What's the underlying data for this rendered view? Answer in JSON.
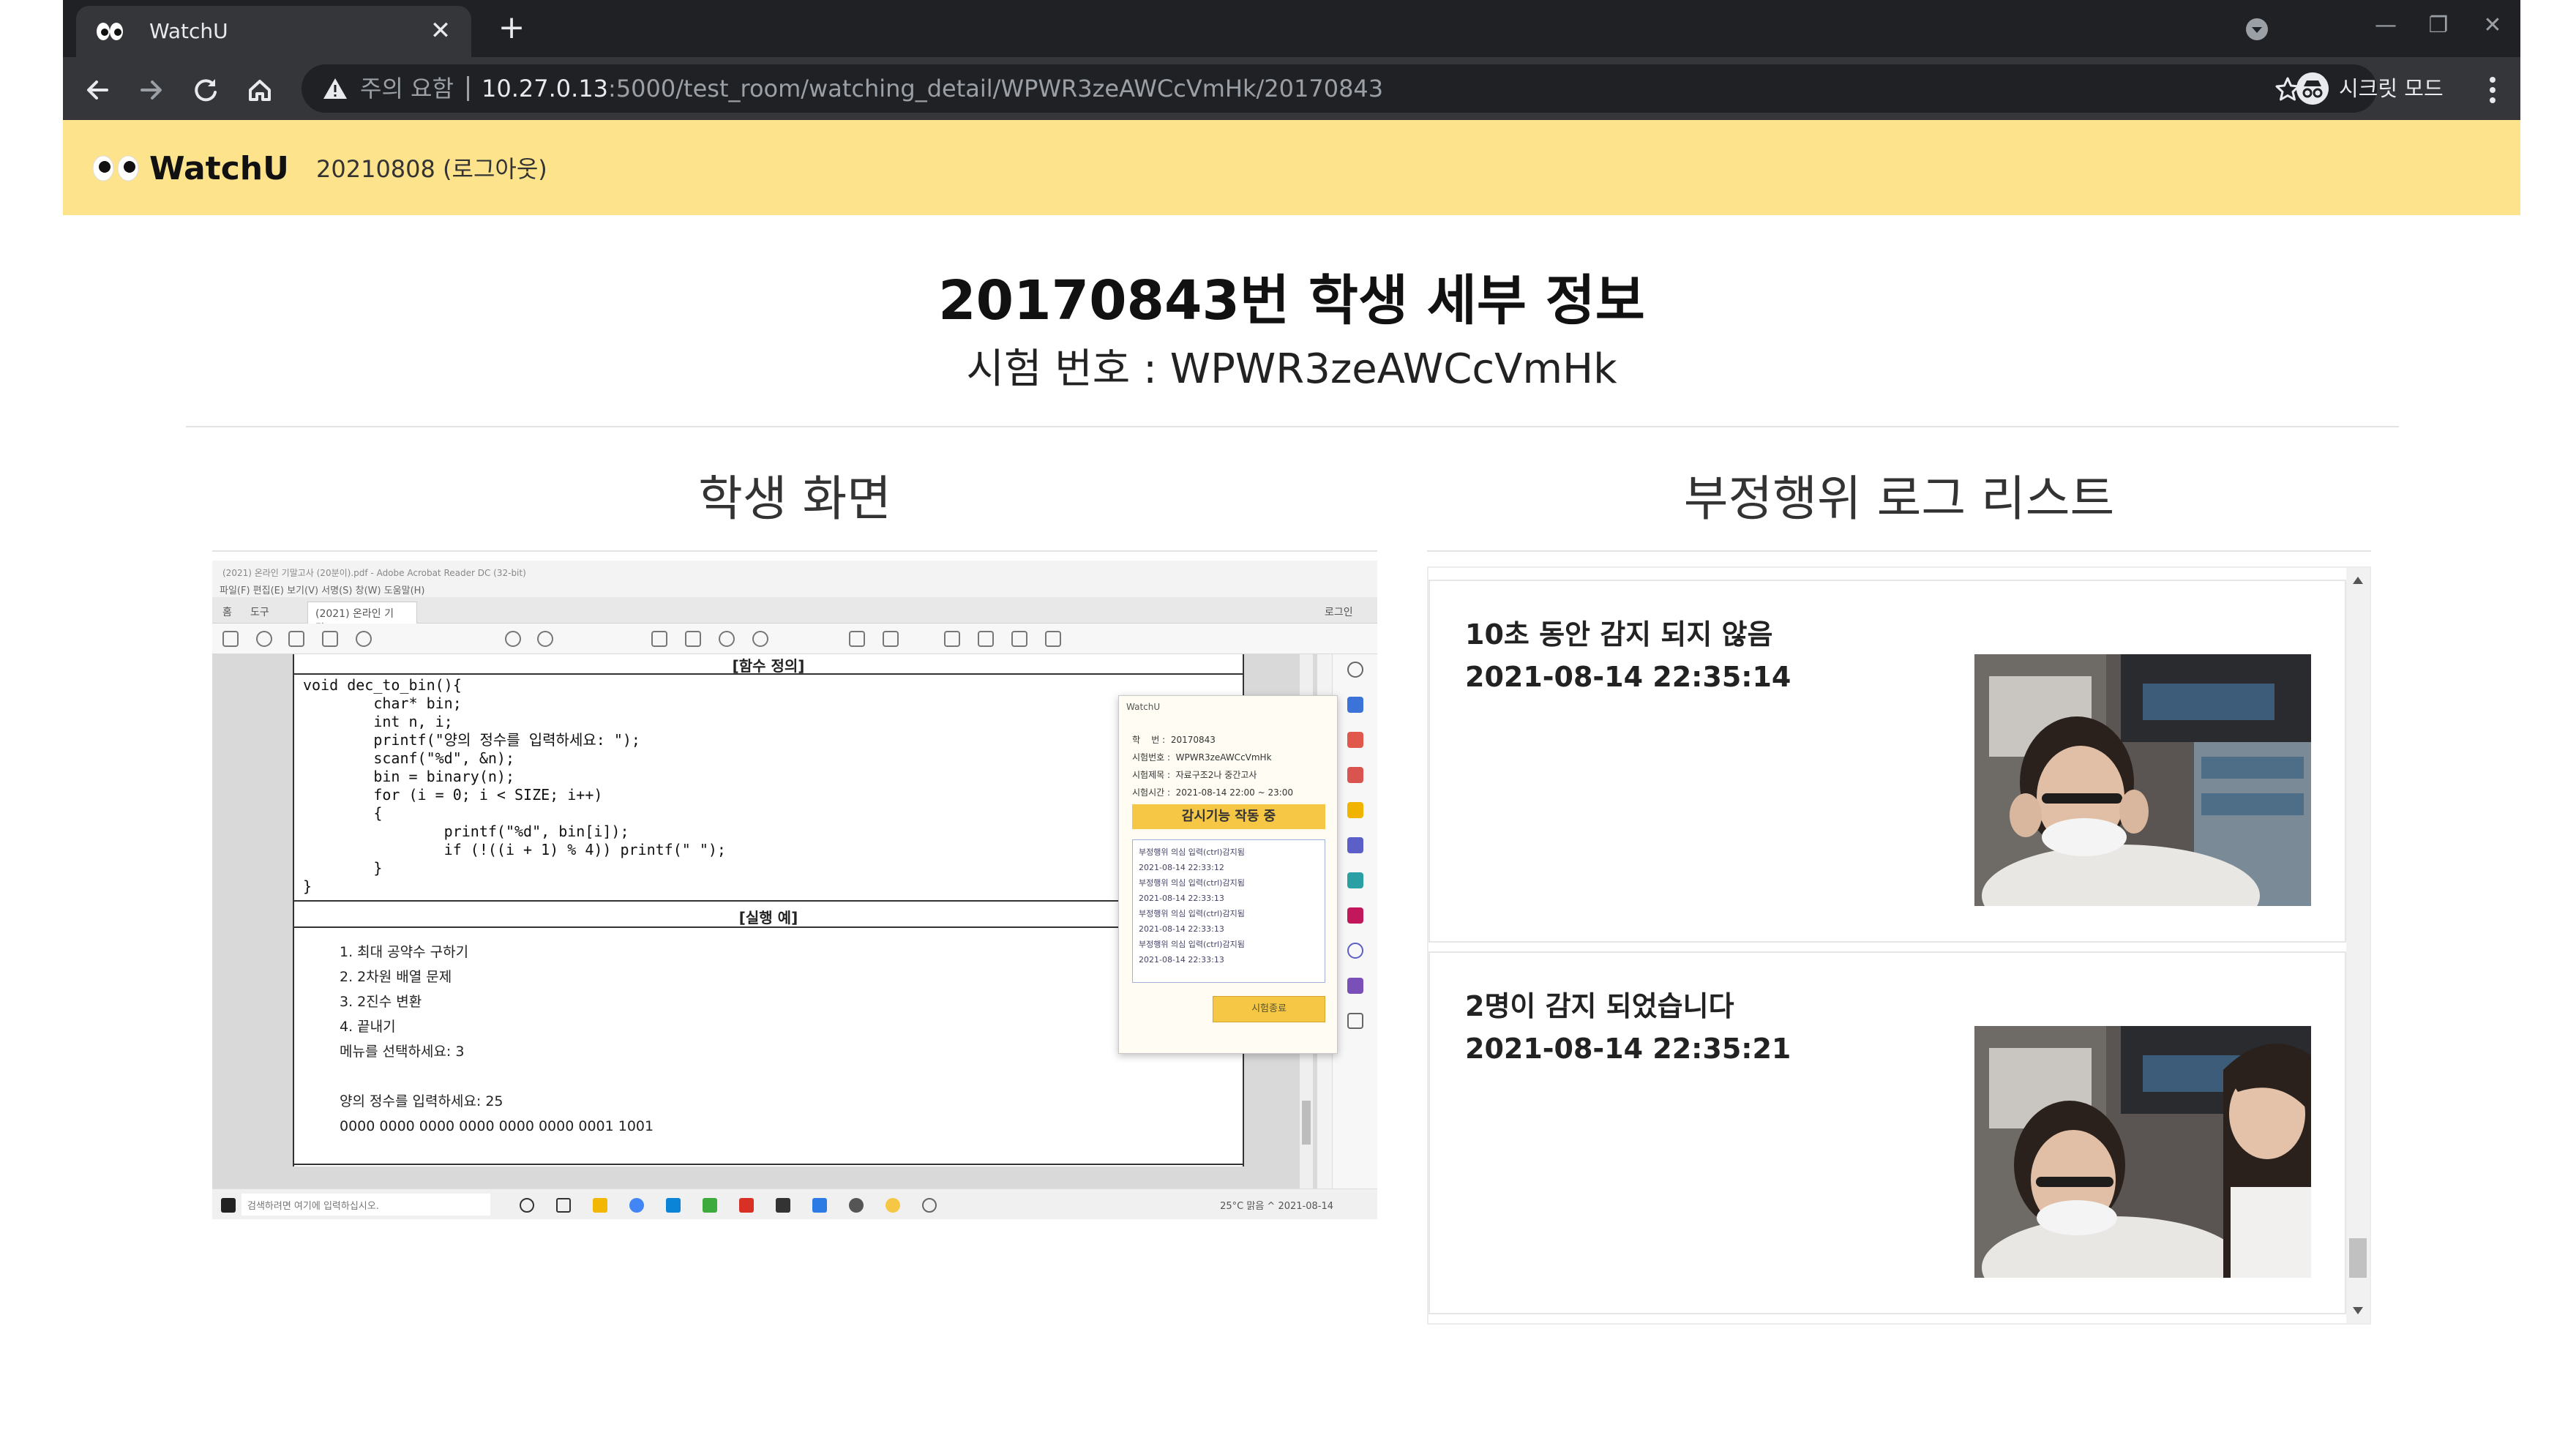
{
  "browser": {
    "tab_title": "WatchU",
    "tab_close": "✕",
    "new_tab": "+",
    "security_warning": "주의 요함",
    "url_host": "10.27.0.13",
    "url_rest": ":5000/test_room/watching_detail/WPWR3zeAWCcVmHk/20170843",
    "incognito_label": "시크릿 모드",
    "window_buttons": {
      "minimize": "—",
      "restore": "❐",
      "close": "✕"
    }
  },
  "app": {
    "name": "WatchU",
    "user_info": "20210808 (로그아웃)"
  },
  "page": {
    "title": "20170843번 학생 세부 정보",
    "exam_line": "시험 번호 : WPWR3zeAWCcVmHk"
  },
  "student_screen": {
    "section_title": "학생 화면",
    "window_title": "(2021) 온라인 기말고사 (20분이).pdf - Adobe Acrobat Reader DC (32-bit)",
    "menu": "파일(F)   편집(E)   보기(V)   서명(S)   창(W)   도움말(H)",
    "tabs": [
      "홈",
      "도구",
      "(2021) 온라인 기말..."
    ],
    "tab_right": "로그인",
    "func_header": "[함수 정의]",
    "code": "void dec_to_bin(){\n        char* bin;\n        int n, i;\n        printf(\"양의 정수를 입력하세요: \");\n        scanf(\"%d\", &n);\n        bin = binary(n);\n        for (i = 0; i < SIZE; i++)\n        {\n                printf(\"%d\", bin[i]);\n                if (!((i + 1) % 4)) printf(\" \");\n        }\n}",
    "run_header": "[실행 예]",
    "output": "1. 최대 공약수 구하기\n2. 2차원 배열 문제\n3. 2진수 변환\n4. 끝내기\n메뉴를 선택하세요: 3\n\n양의 정수를 입력하세요: 25\n0000 0000 0000 0000 0000 0000 0001 1001",
    "taskbar_search": "검색하려면 여기에 입력하십시오.",
    "tray": "25°C 맑음  ^  2021-08-14",
    "popup": {
      "title": "WatchU",
      "info": "학    번 :  20170843\n시험번호 :  WPWR3zeAWCcVmHk\n시험제목 :  자료구조2나 중간고사\n시험시간 :  2021-08-14 22:00 ~ 23:00",
      "status": "감시기능 작동 중",
      "log": "부정행위 의심 입력(ctrl)감지됨\n2021-08-14 22:33:12\n부정행위 의심 입력(ctrl)감지됨\n2021-08-14 22:33:13\n부정행위 의심 입력(ctrl)감지됨\n2021-08-14 22:33:13\n부정행위 의심 입력(ctrl)감지됨\n2021-08-14 22:33:13",
      "end_button": "시험종료"
    }
  },
  "log_list": {
    "section_title": "부정행위 로그 리스트",
    "items": [
      {
        "message": "10초 동안 감지 되지 않음",
        "time": "2021-08-14 22:35:14"
      },
      {
        "message": "2명이 감지 되었습니다",
        "time": "2021-08-14 22:35:21"
      }
    ]
  },
  "colors": {
    "app_header": "#fde38c",
    "chrome_dark": "#202124",
    "chrome_toolbar": "#35363a",
    "popup_status": "#f6c744"
  },
  "icons": [
    "back-icon",
    "forward-icon",
    "reload-icon",
    "home-icon",
    "warning-icon",
    "bookmark-star-icon",
    "incognito-icon",
    "menu-dots-icon",
    "eyes-logo-icon",
    "tab-search-icon"
  ]
}
